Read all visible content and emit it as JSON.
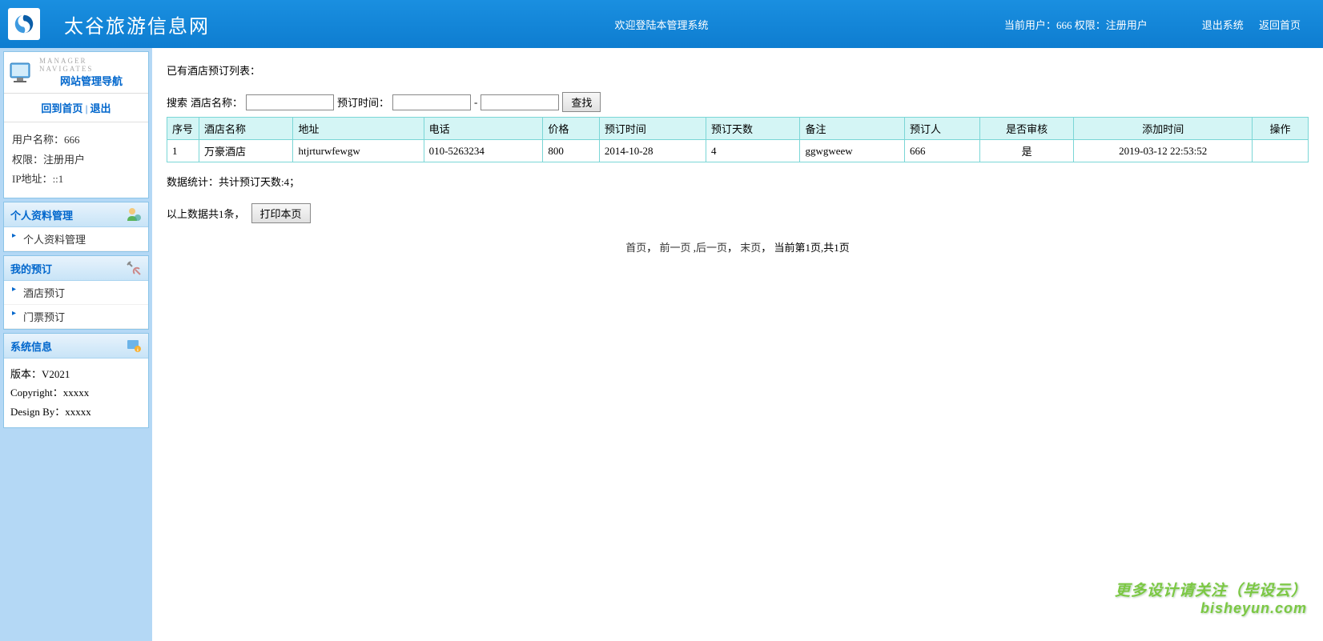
{
  "header": {
    "site_title": "太谷旅游信息网",
    "welcome": "欢迎登陆本管理系统",
    "user_label": "当前用户：",
    "user_value": "666",
    "perm_label": "权限：",
    "perm_value": "注册用户",
    "logout": "退出系统",
    "home": "返回首页"
  },
  "sidebar": {
    "nav_sub": "MANAGER NAVIGATES",
    "nav_title": "网站管理导航",
    "back_home": "回到首页",
    "sep": "|",
    "exit": "退出",
    "user_name_label": "用户名称：",
    "user_name_value": "666",
    "perm_label": "权限：",
    "perm_value": "注册用户",
    "ip_label": "IP地址：",
    "ip_value": "::1",
    "sections": [
      {
        "title": "个人资料管理",
        "items": [
          "个人资料管理"
        ]
      },
      {
        "title": "我的预订",
        "items": [
          "酒店预订",
          "门票预订"
        ]
      },
      {
        "title": "系统信息",
        "items": []
      }
    ],
    "sys_version_label": "版本：",
    "sys_version_value": "V2021",
    "sys_copyright": "Copyright：xxxxx",
    "sys_design": "Design By：xxxxx"
  },
  "content": {
    "list_title": "已有酒店预订列表：",
    "search_label": "搜索",
    "hotel_name_label": "酒店名称：",
    "book_time_label": "预订时间：",
    "date_sep": "-",
    "search_btn": "查找",
    "table": {
      "headers": [
        "序号",
        "酒店名称",
        "地址",
        "电话",
        "价格",
        "预订时间",
        "预订天数",
        "备注",
        "预订人",
        "是否审核",
        "添加时间",
        "操作"
      ],
      "rows": [
        {
          "seq": "1",
          "hotel": "万豪酒店",
          "addr": "htjrturwfewgw",
          "phone": "010-5263234",
          "price": "800",
          "book_time": "2014-10-28",
          "days": "4",
          "remark": "ggwgweew",
          "booker": "666",
          "audited": "是",
          "add_time": "2019-03-12 22:53:52",
          "op": ""
        }
      ]
    },
    "stats": "数据统计：共计预订天数:4；",
    "summary_prefix": "以上数据共1条，",
    "print_btn": "打印本页",
    "pagination": {
      "first": "首页",
      "prev": "前一页",
      "next": "后一页",
      "last": "末页",
      "current": "当前第1页,共1页"
    }
  },
  "watermark": {
    "line1": "更多设计请关注（毕设云）",
    "line2": "bisheyun.com"
  }
}
